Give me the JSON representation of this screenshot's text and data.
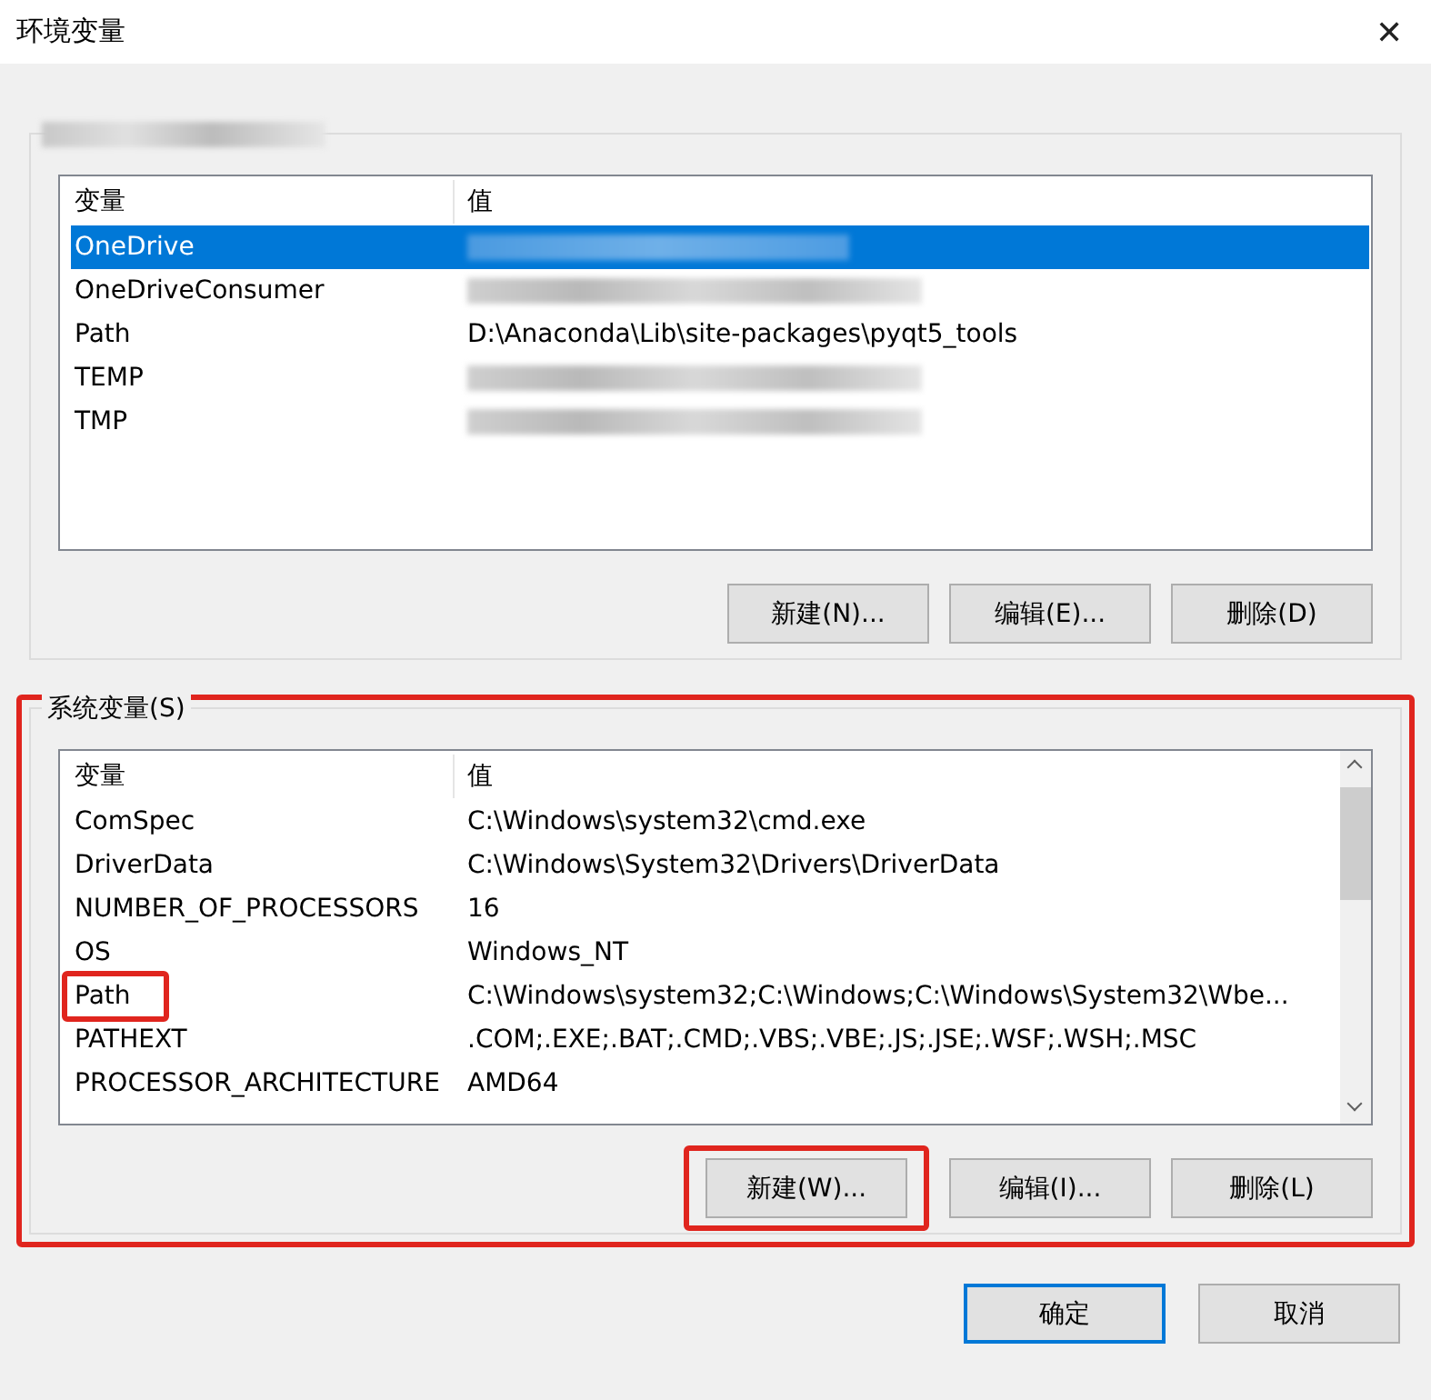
{
  "window": {
    "title": "环境变量",
    "close": "✕"
  },
  "groups": [
    {
      "label_redacted": true,
      "annotated": false,
      "columns": [
        "变量",
        "值"
      ],
      "scrollbar": false,
      "rows": [
        {
          "name": "OneDrive",
          "redacted": true,
          "selected": true,
          "annotated": false
        },
        {
          "name": "OneDriveConsumer",
          "redacted": true,
          "selected": false,
          "annotated": false
        },
        {
          "name": "Path",
          "value": "D:\\Anaconda\\Lib\\site-packages\\pyqt5_tools",
          "redacted": false,
          "selected": false,
          "annotated": false
        },
        {
          "name": "TEMP",
          "redacted": true,
          "selected": false,
          "annotated": false
        },
        {
          "name": "TMP",
          "redacted": true,
          "selected": false,
          "annotated": false
        }
      ],
      "buttons": [
        {
          "label": "新建(N)...",
          "annotated": false
        },
        {
          "label": "编辑(E)...",
          "annotated": false
        },
        {
          "label": "删除(D)",
          "annotated": false
        }
      ]
    },
    {
      "label": "系统变量(S)",
      "label_redacted": false,
      "annotated": true,
      "columns": [
        "变量",
        "值"
      ],
      "scrollbar": true,
      "rows": [
        {
          "name": "ComSpec",
          "value": "C:\\Windows\\system32\\cmd.exe",
          "redacted": false,
          "selected": false,
          "annotated": false
        },
        {
          "name": "DriverData",
          "value": "C:\\Windows\\System32\\Drivers\\DriverData",
          "redacted": false,
          "selected": false,
          "annotated": false
        },
        {
          "name": "NUMBER_OF_PROCESSORS",
          "value": "16",
          "redacted": false,
          "selected": false,
          "annotated": false
        },
        {
          "name": "OS",
          "value": "Windows_NT",
          "redacted": false,
          "selected": false,
          "annotated": false
        },
        {
          "name": "Path",
          "value": "C:\\Windows\\system32;C:\\Windows;C:\\Windows\\System32\\Wbe...",
          "redacted": false,
          "selected": false,
          "annotated": true
        },
        {
          "name": "PATHEXT",
          "value": ".COM;.EXE;.BAT;.CMD;.VBS;.VBE;.JS;.JSE;.WSF;.WSH;.MSC",
          "redacted": false,
          "selected": false,
          "annotated": false
        },
        {
          "name": "PROCESSOR_ARCHITECTURE",
          "value": "AMD64",
          "redacted": false,
          "selected": false,
          "annotated": false
        }
      ],
      "buttons": [
        {
          "label": "新建(W)...",
          "annotated": true
        },
        {
          "label": "编辑(I)...",
          "annotated": false
        },
        {
          "label": "删除(L)",
          "annotated": false
        }
      ]
    }
  ],
  "footer_buttons": [
    {
      "label": "确定",
      "default": true
    },
    {
      "label": "取消",
      "default": false
    }
  ]
}
